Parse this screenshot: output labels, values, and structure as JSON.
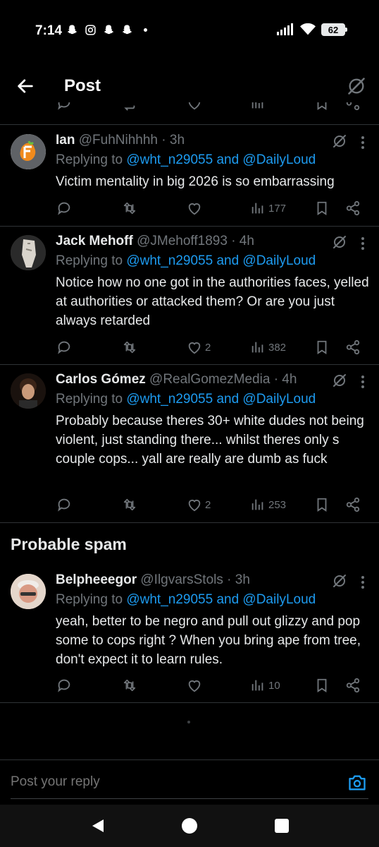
{
  "status_bar": {
    "time": "7:14",
    "battery": "62",
    "icons_left": [
      "snapchat-icon",
      "instagram-icon",
      "snapchat-icon",
      "snapchat-icon",
      "dot"
    ],
    "icons_right": [
      "signal-icon",
      "wifi-icon",
      "battery-icon"
    ]
  },
  "header": {
    "title": "Post",
    "back_icon": "arrow-left-icon",
    "grok_icon": "grok-icon"
  },
  "tweets": [
    {
      "name": "Ian",
      "handle": "@FuhNihhhh",
      "time": "· 3h",
      "replying_prefix": "Replying to ",
      "mentions": "@wht_n29055 and @DailyLoud",
      "text": "Victim mentality in big 2026 is so embarrassing",
      "likes": "",
      "views": "177"
    },
    {
      "name": "Jack Mehoff",
      "handle": "@JMehoff1893",
      "time": "· 4h",
      "replying_prefix": "Replying to ",
      "mentions": "@wht_n29055 and @DailyLoud",
      "text": "Notice how no one got in the authorities faces, yelled at authorities or attacked them? Or are you just always retarded",
      "likes": "2",
      "views": "382"
    },
    {
      "name": "Carlos Gómez",
      "handle": "@RealGomezMedia",
      "time": "· 4h",
      "replying_prefix": "Replying to ",
      "mentions": "@wht_n29055 and @DailyLoud",
      "text": "Probably because theres 30+ white dudes not being violent, just standing there... whilst theres only s couple cops... yall are really are dumb as fuck",
      "likes": "2",
      "views": "253"
    },
    {
      "name": "Belpheeegor",
      "handle": "@IlgvarsStols",
      "time": "· 3h",
      "replying_prefix": "Replying to ",
      "mentions": "@wht_n29055 and @DailyLoud",
      "text": "yeah, better to be negro and pull out glizzy and pop some to cops right ? When you bring ape from tree, don't expect it to learn rules.",
      "likes": "",
      "views": "10"
    }
  ],
  "probable_spam_title": "Probable spam",
  "reply_bar": {
    "placeholder": "Post your reply",
    "camera_icon": "camera-icon"
  },
  "nav": {
    "back": "nav-back-icon",
    "home": "nav-home-icon",
    "recent": "nav-recent-icon"
  },
  "colors": {
    "background": "#000000",
    "text": "#e7e9ea",
    "muted": "#71767b",
    "accent": "#1d9bf0",
    "divider": "#2f3336"
  }
}
